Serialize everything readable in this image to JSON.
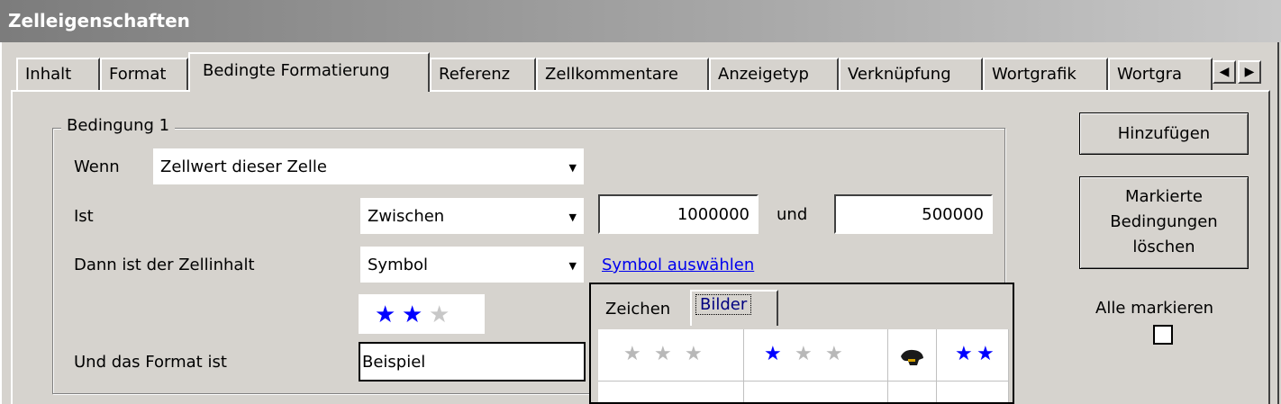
{
  "window": {
    "title": "Zelleigenschaften"
  },
  "tabs": [
    {
      "label": "Inhalt",
      "active": false
    },
    {
      "label": "Format",
      "active": false
    },
    {
      "label": "Bedingte Formatierung",
      "active": true
    },
    {
      "label": "Referenz",
      "active": false
    },
    {
      "label": "Zellkommentare",
      "active": false
    },
    {
      "label": "Anzeigetyp",
      "active": false
    },
    {
      "label": "Verknüpfung",
      "active": false
    },
    {
      "label": "Wortgrafik",
      "active": false
    },
    {
      "label": "Wortgra",
      "active": false
    }
  ],
  "tab_scroll": {
    "left_icon": "◀",
    "right_icon": "▶"
  },
  "condition": {
    "group_title": "Bedingung 1",
    "wenn_label": "Wenn",
    "wenn_value": "Zellwert dieser Zelle",
    "ist_label": "Ist",
    "ist_value": "Zwischen",
    "value1": "1000000",
    "und_label": "und",
    "value2": "500000",
    "dann_label": "Dann ist der Zellinhalt",
    "dann_value": "Symbol",
    "symbol_link": "Symbol auswählen",
    "format_label": "Und das Format ist",
    "format_sample": "Beispiel",
    "dropdown_arrow": "▼"
  },
  "symbol_preview": {
    "filled_stars": 2,
    "total_stars": 3
  },
  "buttons": {
    "add": "Hinzufügen",
    "delete_line1": "Markierte",
    "delete_line2": "Bedingungen",
    "delete_line3": "löschen"
  },
  "select_all": {
    "label": "Alle markieren",
    "checked": false
  },
  "symbol_picker": {
    "tabs": [
      {
        "label": "Zeichen",
        "active": false
      },
      {
        "label": "Bilder",
        "active": true
      }
    ],
    "cells": [
      {
        "icon": "three-grey-stars",
        "filled": 0
      },
      {
        "icon": "one-of-three-stars",
        "filled": 1
      },
      {
        "icon": "dog-icon"
      },
      {
        "icon": "two-blue-stars",
        "filled": 2
      }
    ]
  },
  "colors": {
    "star_filled": "#0000ff",
    "star_empty": "#b8b8b8",
    "link": "#0000ee"
  }
}
